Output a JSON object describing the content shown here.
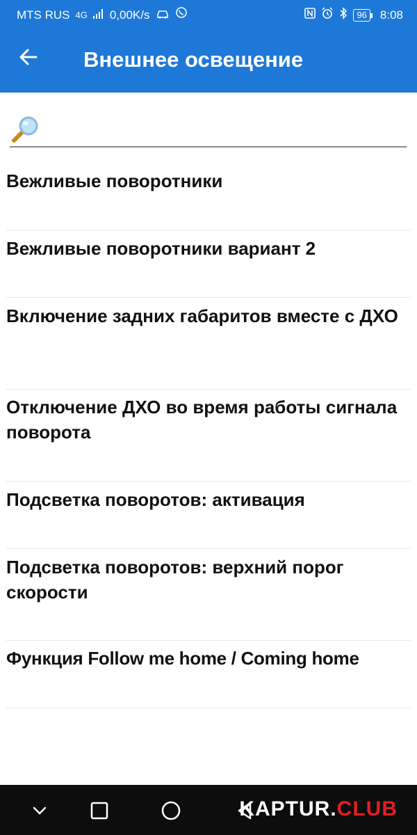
{
  "status_bar": {
    "carrier": "MTS RUS",
    "network": "4G",
    "speed": "0,00K/s",
    "battery": "96",
    "time": "8:08",
    "icons": [
      "car-icon",
      "viber-icon",
      "nfc-icon",
      "alarm-icon",
      "bluetooth-icon",
      "battery-icon"
    ]
  },
  "header": {
    "title": "Внешнее освещение",
    "back_icon": "arrow-left-icon"
  },
  "search": {
    "value": "",
    "placeholder": "",
    "icon": "magnifier-icon"
  },
  "list": {
    "items": [
      {
        "label": "Вежливые поворотники"
      },
      {
        "label": "Вежливые поворотники вариант 2"
      },
      {
        "label": "Включение задних габаритов вместе с ДХО"
      },
      {
        "label": "Отключение ДХО во время работы сигнала поворота"
      },
      {
        "label": "Подсветка поворотов: активация"
      },
      {
        "label": "Подсветка поворотов: верхний порог скорости"
      },
      {
        "label": "Функция Follow me home / Coming home"
      }
    ]
  },
  "nav_bar": {
    "buttons": [
      "chevron-down-icon",
      "square-icon",
      "circle-icon",
      "triangle-back-icon"
    ]
  },
  "watermark": {
    "part1": "KAPTUR.",
    "part2": "CLUB"
  },
  "colors": {
    "appbar": "#1e78d7",
    "navbar": "#0d0d0d",
    "watermark_accent": "#e02020"
  }
}
